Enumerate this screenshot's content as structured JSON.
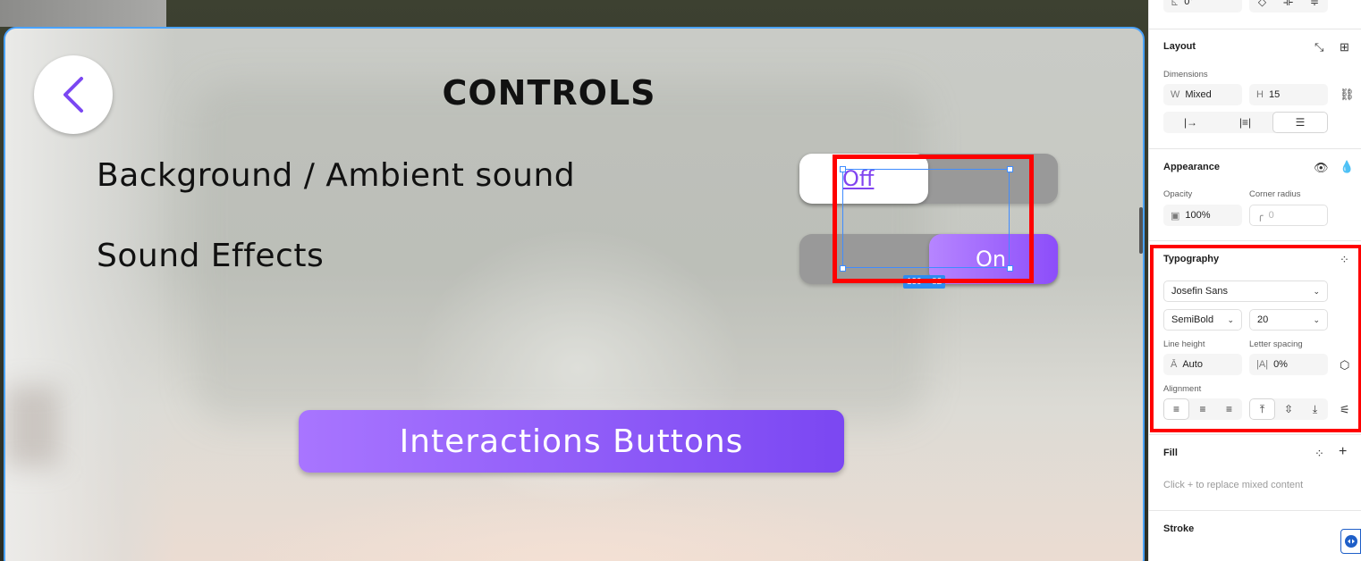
{
  "canvas": {
    "title": "CONTROLS",
    "settings": [
      {
        "label": "Background / Ambient sound",
        "toggle_value": "Off"
      },
      {
        "label": "Sound Effects",
        "toggle_value": "On"
      }
    ],
    "selection_dims": "139 × 82",
    "cta_label": "Interactions Buttons",
    "accent": "#8c4dfa"
  },
  "panel": {
    "rotation_value": "0°",
    "layout": {
      "title": "Layout",
      "dimensions_label": "Dimensions",
      "w_prefix": "W",
      "w_value": "Mixed",
      "h_prefix": "H",
      "h_value": "15"
    },
    "appearance": {
      "title": "Appearance",
      "opacity_label": "Opacity",
      "opacity_value": "100%",
      "radius_label": "Corner radius",
      "radius_placeholder": "0"
    },
    "typography": {
      "title": "Typography",
      "font_family": "Josefin Sans",
      "font_weight": "SemiBold",
      "font_size": "20",
      "line_height_label": "Line height",
      "line_height_value": "Auto",
      "letter_spacing_label": "Letter spacing",
      "letter_spacing_value": "0%",
      "alignment_label": "Alignment"
    },
    "fill": {
      "title": "Fill",
      "hint": "Click + to replace mixed content"
    },
    "stroke": {
      "title": "Stroke"
    }
  }
}
